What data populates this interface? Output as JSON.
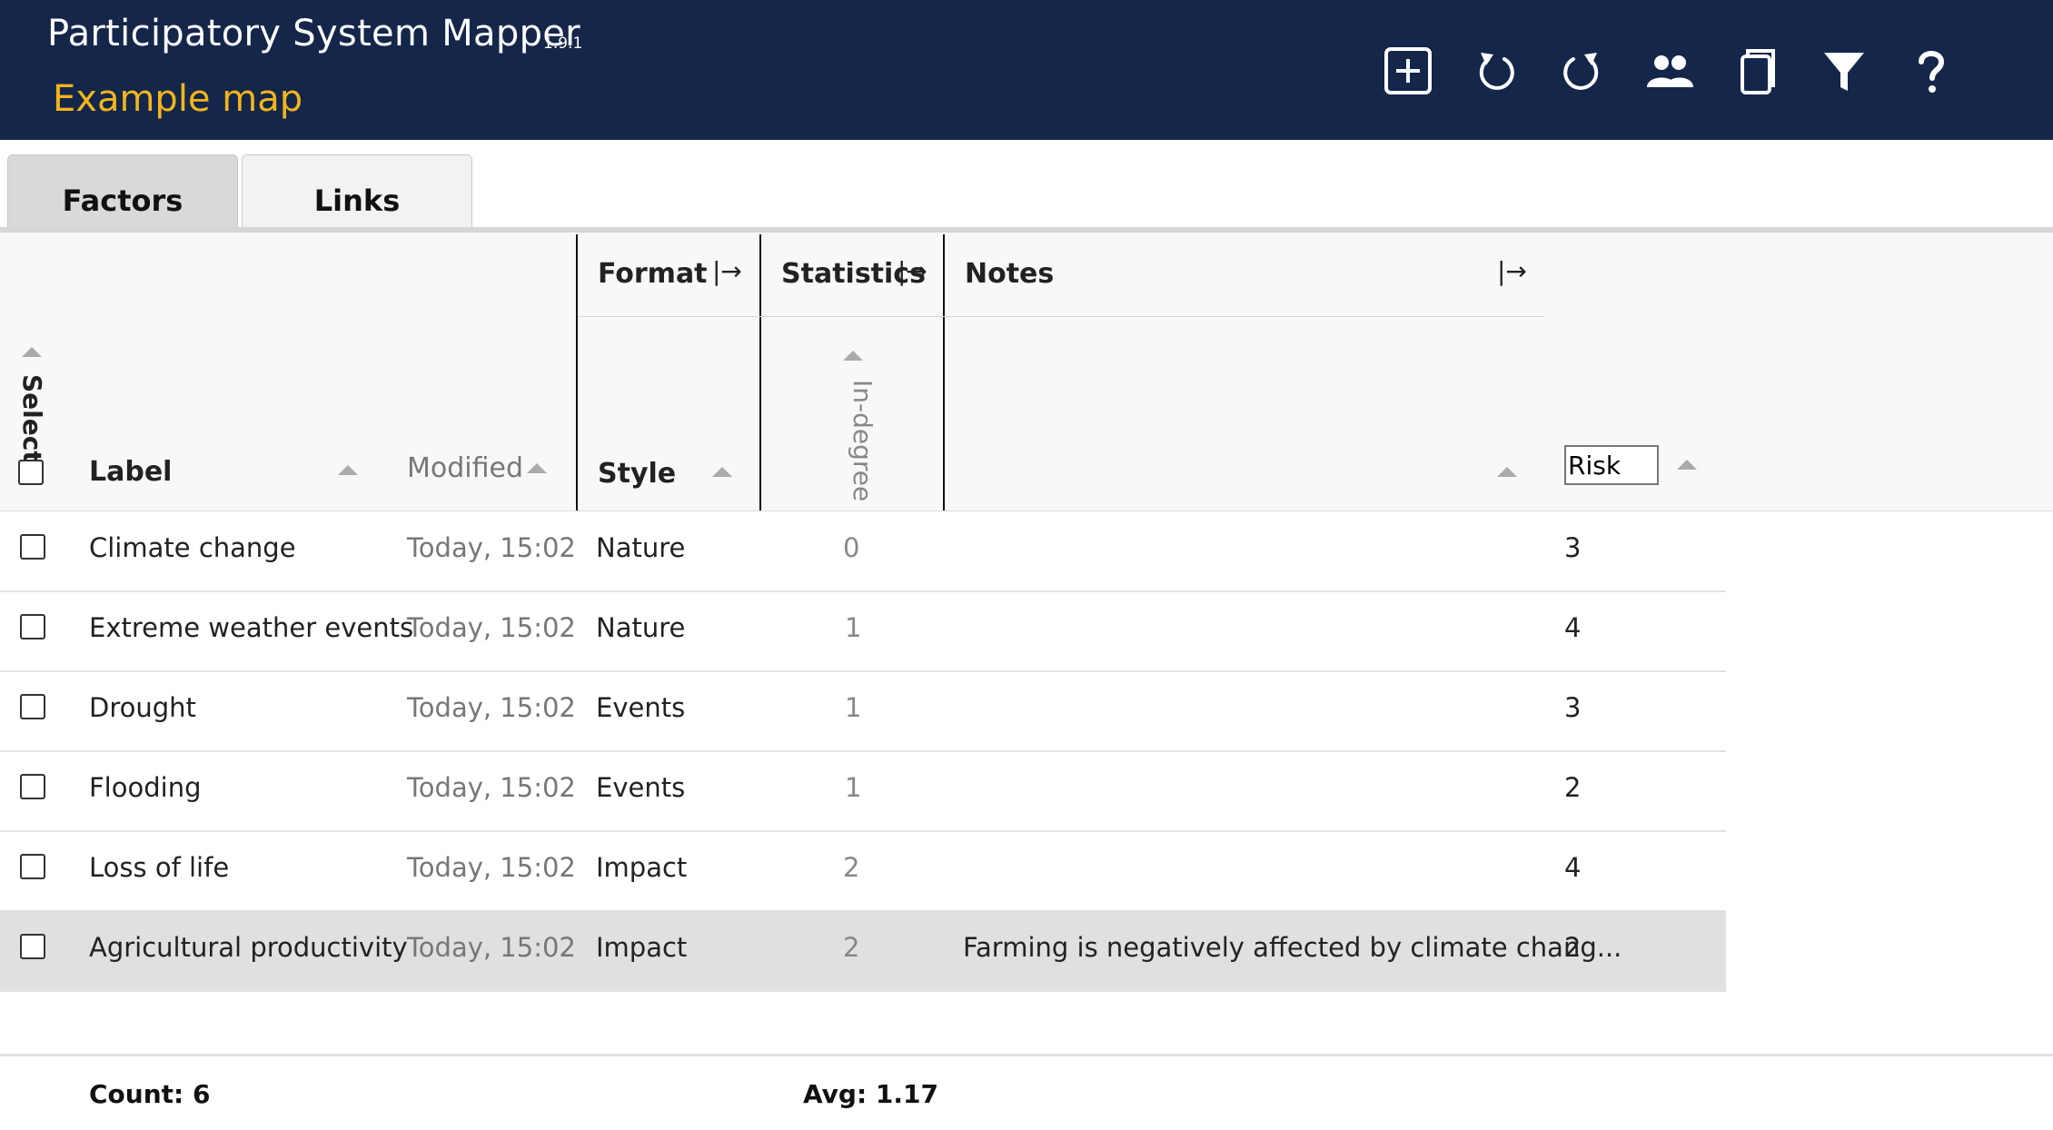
{
  "app": {
    "title": "Participatory System Mapper",
    "version": "1.9.1",
    "map_title": "Example map"
  },
  "toolbar": [
    {
      "name": "add-node-icon"
    },
    {
      "name": "undo-icon"
    },
    {
      "name": "redo-icon"
    },
    {
      "name": "users-icon"
    },
    {
      "name": "copy-icon"
    },
    {
      "name": "filter-icon"
    },
    {
      "name": "help-icon"
    }
  ],
  "tabs": {
    "factors": "Factors",
    "links": "Links"
  },
  "table": {
    "groups": {
      "format": "Format",
      "statistics": "Statistics",
      "notes": "Notes"
    },
    "headers": {
      "select": "Select",
      "label": "Label",
      "modified": "Modified",
      "style": "Style",
      "in_degree": "In-degree",
      "risk_filter": "Risk"
    },
    "rows": [
      {
        "label": "Climate change",
        "modified": "Today, 15:02",
        "style": "Nature",
        "in_degree": "0",
        "notes": "",
        "risk": "3"
      },
      {
        "label": "Extreme weather events",
        "modified": "Today, 15:02",
        "style": "Nature",
        "in_degree": "1",
        "notes": "",
        "risk": "4"
      },
      {
        "label": "Drought",
        "modified": "Today, 15:02",
        "style": "Events",
        "in_degree": "1",
        "notes": "",
        "risk": "3"
      },
      {
        "label": "Flooding",
        "modified": "Today, 15:02",
        "style": "Events",
        "in_degree": "1",
        "notes": "",
        "risk": "2"
      },
      {
        "label": "Loss of life",
        "modified": "Today, 15:02",
        "style": "Impact",
        "in_degree": "2",
        "notes": "",
        "risk": "4"
      },
      {
        "label": "Agricultural productivity",
        "modified": "Today, 15:02",
        "style": "Impact",
        "in_degree": "2",
        "notes": "Farming is negatively affected by climate chang...",
        "risk": "2"
      }
    ]
  },
  "footer": {
    "count": "Count: 6",
    "avg": "Avg: 1.17"
  },
  "colors": {
    "header_bg": "#14264a",
    "map_title": "#f2b51b",
    "selected_row": "#e0e0e0"
  }
}
